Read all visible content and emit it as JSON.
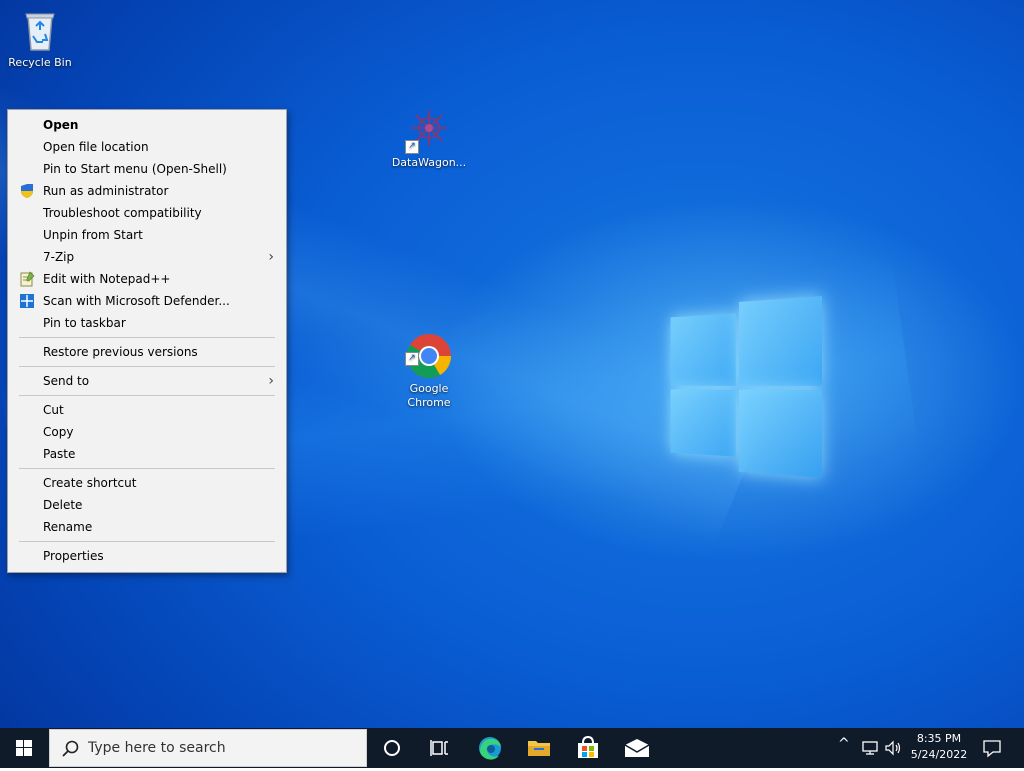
{
  "desktop": {
    "icons": [
      {
        "label": "Recycle Bin",
        "icon": "recycle-bin-icon"
      },
      {
        "label": "DataWagon...",
        "icon": "datawagon-icon"
      },
      {
        "label": "Google\nChrome",
        "icon": "chrome-icon"
      }
    ]
  },
  "context_menu": {
    "items": [
      {
        "label": "Open",
        "bold": true
      },
      {
        "label": "Open file location"
      },
      {
        "label": "Pin to Start menu (Open-Shell)"
      },
      {
        "label": "Run as administrator",
        "icon": "shield-icon"
      },
      {
        "label": "Troubleshoot compatibility"
      },
      {
        "label": "Unpin from Start"
      },
      {
        "label": "7-Zip",
        "submenu": true
      },
      {
        "label": "Edit with Notepad++",
        "icon": "notepad-plus-plus-icon"
      },
      {
        "label": "Scan with Microsoft Defender...",
        "icon": "defender-icon"
      },
      {
        "label": "Pin to taskbar"
      },
      {
        "label": "Restore previous versions"
      },
      {
        "label": "Send to",
        "submenu": true
      },
      {
        "label": "Cut"
      },
      {
        "label": "Copy"
      },
      {
        "label": "Paste"
      },
      {
        "label": "Create shortcut"
      },
      {
        "label": "Delete"
      },
      {
        "label": "Rename"
      },
      {
        "label": "Properties"
      }
    ],
    "submenu_arrow": "›"
  },
  "taskbar": {
    "search_placeholder": "Type here to search",
    "apps": [
      "cortana-icon",
      "task-view-icon",
      "edge-icon",
      "file-explorer-icon",
      "store-icon",
      "mail-icon"
    ],
    "tray": {
      "chevron": "^",
      "time": "8:35 PM",
      "date": "5/24/2022"
    }
  },
  "colors": {
    "taskbar": "#101b2a",
    "desktop_accent": "#0a5ed4",
    "menu_bg": "#f2f2f2"
  }
}
